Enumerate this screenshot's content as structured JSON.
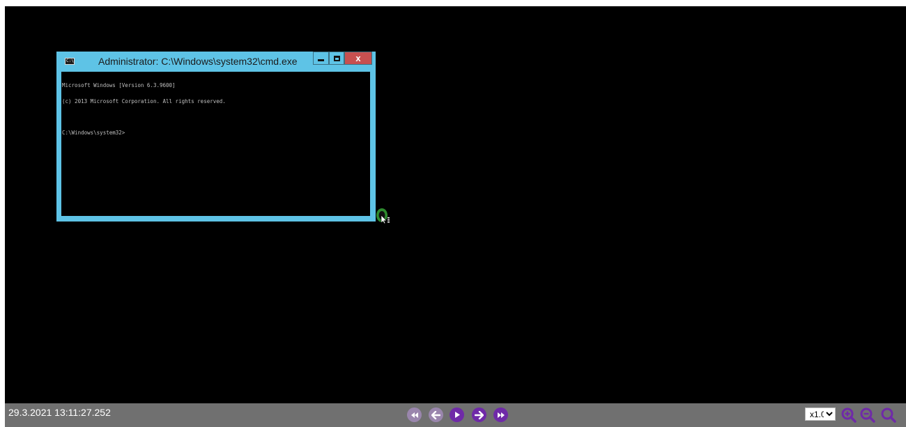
{
  "cmd_window": {
    "title": "Administrator: C:\\Windows\\system32\\cmd.exe",
    "app_icon_text": "C:\\",
    "close_label": "x",
    "console_lines": [
      "Microsoft Windows [Version 6.3.9600]",
      "(c) 2013 Microsoft Corporation. All rights reserved.",
      "",
      "C:\\Windows\\system32>"
    ]
  },
  "player": {
    "timestamp": "29.3.2021 13:11:27.252",
    "zoom_options": [
      "x1.0"
    ],
    "zoom_selected": "x1.0",
    "controls": [
      "skip-to-start",
      "step-back",
      "play",
      "step-forward",
      "skip-to-end"
    ]
  },
  "colors": {
    "cmd_frame": "#5ec3e6",
    "close_button": "#c75050",
    "player_bar": "#707070",
    "control_accent": "#6f2aa8",
    "cursor_highlight": "#2e8b2e"
  }
}
